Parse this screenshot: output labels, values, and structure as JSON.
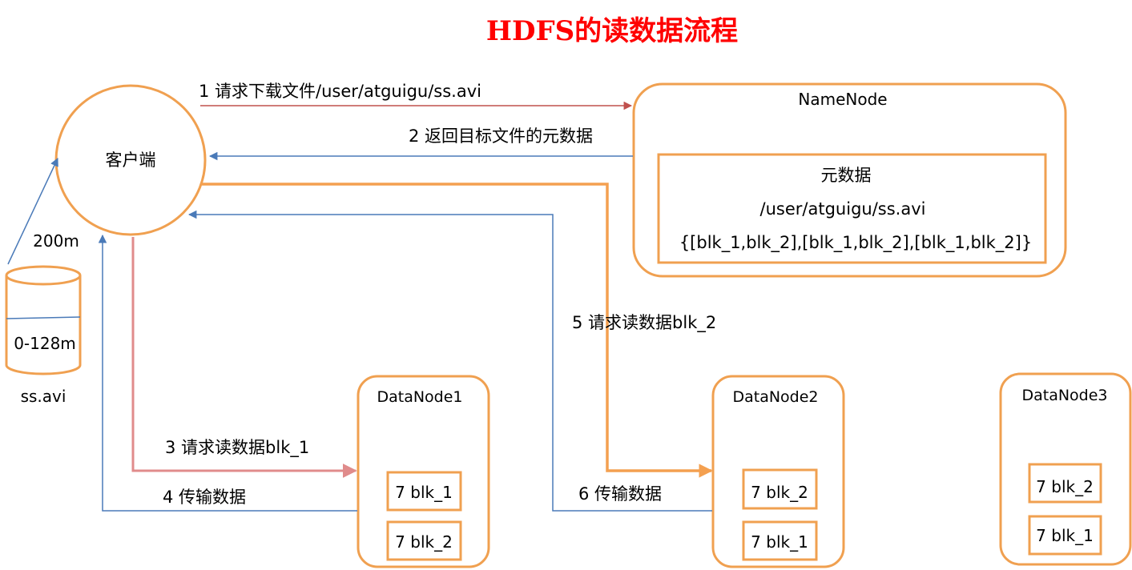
{
  "title": "HDFS的读数据流程",
  "colors": {
    "title": "#ff0000",
    "orange": "#f0a050",
    "blue_line": "#4a7ab8",
    "red_line": "#c0504d",
    "pink_line": "#e08b8b",
    "orange_line": "#f4a050"
  },
  "client": {
    "label": "客户端"
  },
  "file": {
    "size_label": "200m",
    "block_label": "0-128m",
    "name": "ss.avi"
  },
  "namenode": {
    "label": "NameNode",
    "metadata": {
      "heading": "元数据",
      "path": "/user/atguigu/ss.avi",
      "blocks": "{[blk_1,blk_2],[blk_1,blk_2],[blk_1,blk_2]}"
    }
  },
  "datanodes": [
    {
      "label": "DataNode1",
      "blocks": [
        "7 blk_1",
        "7 blk_2"
      ]
    },
    {
      "label": "DataNode2",
      "blocks": [
        "7 blk_2",
        "7 blk_1"
      ]
    },
    {
      "label": "DataNode3",
      "blocks": [
        "7 blk_2",
        "7 blk_1"
      ]
    }
  ],
  "steps": {
    "s1": "1 请求下载文件/user/atguigu/ss.avi",
    "s2": "2 返回目标文件的元数据",
    "s3": "3 请求读数据blk_1",
    "s4": "4 传输数据",
    "s5": "5 请求读数据blk_2",
    "s6": "6 传输数据"
  }
}
